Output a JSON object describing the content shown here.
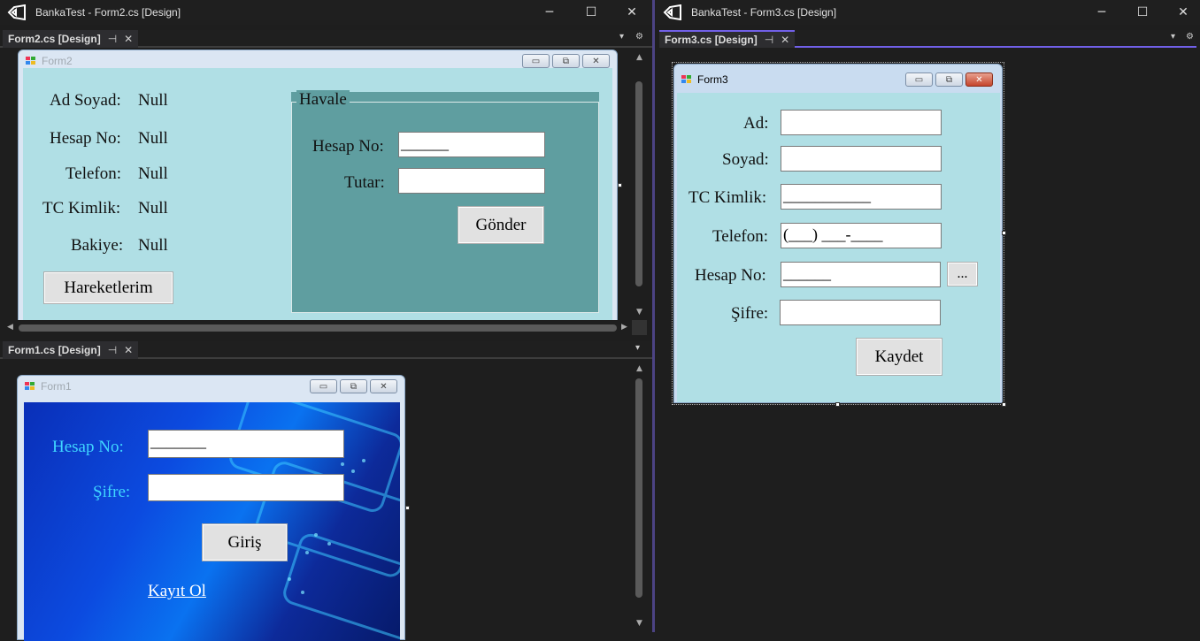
{
  "left_window": {
    "title": "BankaTest - Form2.cs [Design]"
  },
  "right_window": {
    "title": "BankaTest - Form3.cs [Design]"
  },
  "tabs": {
    "form2": {
      "label": "Form2.cs [Design]"
    },
    "form1": {
      "label": "Form1.cs [Design]"
    },
    "form3": {
      "label": "Form3.cs [Design]"
    }
  },
  "glyphs": {
    "pin": "⊣",
    "close": "✕",
    "dropdown": "▾",
    "gear": "⚙",
    "min": "─",
    "max": "☐",
    "win_close": "✕"
  },
  "form2": {
    "title": "Form2",
    "labels": [
      {
        "name": "Ad Soyad:",
        "value": "Null"
      },
      {
        "name": "Hesap No:",
        "value": "Null"
      },
      {
        "name": "Telefon:",
        "value": "Null"
      },
      {
        "name": "TC Kimlik:",
        "value": "Null"
      },
      {
        "name": "Bakiye:",
        "value": "Null"
      }
    ],
    "hareketlerim_button": "Hareketlerim",
    "groupbox": {
      "title": "Havale",
      "hesap_no_label": "Hesap No:",
      "hesap_no_value": "______",
      "tutar_label": "Tutar:",
      "tutar_value": "",
      "send_button": "Gönder"
    }
  },
  "form1": {
    "title": "Form1",
    "hesap_no_label": "Hesap No:",
    "hesap_no_value": "_______",
    "sifre_label": "Şifre:",
    "sifre_value": "",
    "login_button": "Giriş",
    "register_link": "Kayıt Ol"
  },
  "form3": {
    "title": "Form3",
    "fields": {
      "ad": {
        "label": "Ad:",
        "value": ""
      },
      "soyad": {
        "label": "Soyad:",
        "value": ""
      },
      "tc": {
        "label": "TC Kimlik:",
        "value": "___________"
      },
      "telefon": {
        "label": "Telefon:",
        "value": "(___) ___-____"
      },
      "hesap_no": {
        "label": "Hesap No:",
        "value": "______"
      },
      "sifre": {
        "label": "Şifre:",
        "value": ""
      }
    },
    "browse_button": "...",
    "save_button": "Kaydet"
  },
  "colors": {
    "form_back": "#b0dfe5",
    "groupbox_back": "#5f9ea0",
    "tab_accent": "#7160e8"
  }
}
